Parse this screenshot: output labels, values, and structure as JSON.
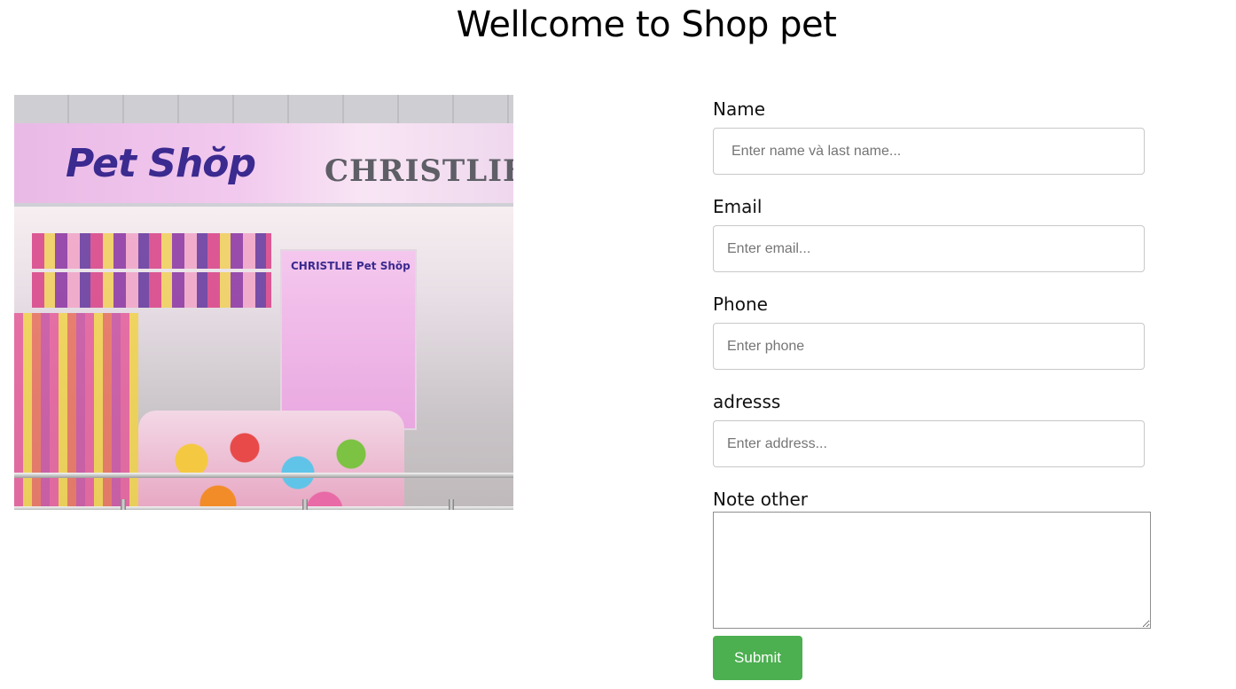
{
  "header": {
    "title": "Wellcome to Shop pet"
  },
  "photo": {
    "brand_left": "Pet Shŏp",
    "brand_right": "CHRISTLIE",
    "poster_text": "CHRISTLIE Pet Shŏp"
  },
  "form": {
    "name": {
      "label": "Name",
      "placeholder": "Enter name và last name...",
      "value": ""
    },
    "email": {
      "label": "Email",
      "placeholder": "Enter email...",
      "value": ""
    },
    "phone": {
      "label": "Phone",
      "placeholder": "Enter phone",
      "value": ""
    },
    "address": {
      "label": "adresss",
      "placeholder": "Enter address...",
      "value": ""
    },
    "note": {
      "label": "Note other",
      "value": ""
    },
    "submit_label": "Submit",
    "submit_color": "#4caf50"
  }
}
